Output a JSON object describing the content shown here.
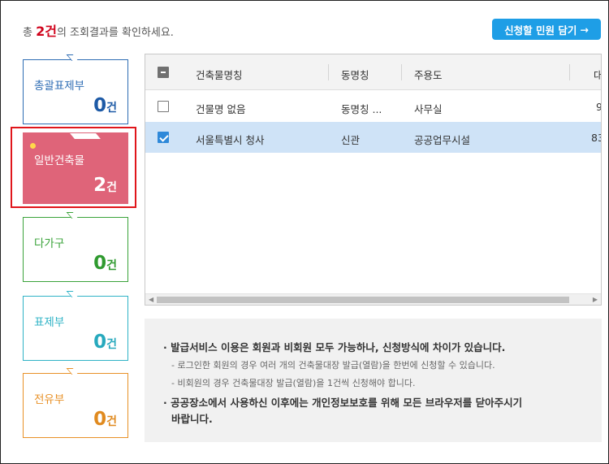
{
  "summary": {
    "prefix": "총 ",
    "count": "2건",
    "suffix": "의 조회결과를 확인하세요."
  },
  "apply_button": {
    "label": "신청할 민원 담기",
    "icon": "arrow-right-icon"
  },
  "cards": [
    {
      "label": "총괄표제부",
      "count": "0",
      "unit": "건"
    },
    {
      "label": "일반건축물",
      "count": "2",
      "unit": "건"
    },
    {
      "label": "다가구",
      "count": "0",
      "unit": "건"
    },
    {
      "label": "표제부",
      "count": "0",
      "unit": "건"
    },
    {
      "label": "전유부",
      "count": "0",
      "unit": "건"
    }
  ],
  "table": {
    "columns": [
      "건축물명칭",
      "동명칭",
      "주용도",
      "대"
    ],
    "rows": [
      {
        "checked": false,
        "name": "건물명 없음",
        "dong": "동명칭 ...",
        "use": "사무실",
        "extra": "9"
      },
      {
        "checked": true,
        "name": "서울특별시 청사",
        "dong": "신관",
        "use": "공공업무시설",
        "extra": "83"
      }
    ]
  },
  "notice": {
    "items": [
      "· 발급서비스 이용은 회원과 비회원 모두 가능하나, 신청방식에 차이가 있습니다.",
      "· 공공장소에서 사용하신 이후에는 개인정보보호를 위해 모든 브라우저를 닫아주시기",
      "바랍니다."
    ],
    "subs": [
      "- 로그인한 회원의 경우 여러 개의 건축물대장 발급(열람)을 한번에 신청할 수 있습니다.",
      "- 비회원의 경우 건축물대장 발급(열람)을 1건씩 신청해야 합니다."
    ]
  },
  "colors": {
    "accent": "#1e9ee6",
    "selected_card": "#df6479",
    "selection_outline": "#e0161b",
    "selected_row": "#cfe3f7"
  }
}
